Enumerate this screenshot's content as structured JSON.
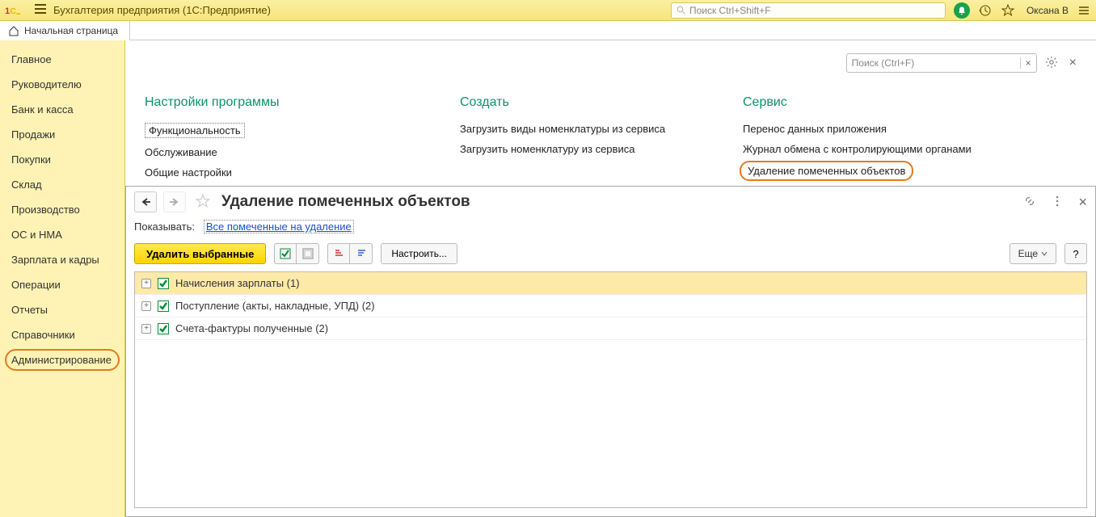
{
  "titlebar": {
    "app_title": "Бухгалтерия предприятия  (1С:Предприятие)",
    "search_placeholder": "Поиск Ctrl+Shift+F",
    "user": "Оксана В"
  },
  "tabs": {
    "home": "Начальная страница"
  },
  "sidebar": {
    "items": [
      "Главное",
      "Руководителю",
      "Банк и касса",
      "Продажи",
      "Покупки",
      "Склад",
      "Производство",
      "ОС и НМА",
      "Зарплата и кадры",
      "Операции",
      "Отчеты",
      "Справочники",
      "Администрирование"
    ]
  },
  "admin": {
    "search_placeholder": "Поиск (Ctrl+F)",
    "col1_title": "Настройки программы",
    "col1": [
      "Функциональность",
      "Обслуживание",
      "Общие настройки"
    ],
    "col2_title": "Создать",
    "col2": [
      "Загрузить виды номенклатуры из сервиса",
      "Загрузить номенклатуру из сервиса"
    ],
    "col3_title": "Сервис",
    "col3": [
      "Перенос данных приложения",
      "Журнал обмена с контролирующими органами",
      "Удаление помеченных объектов"
    ]
  },
  "overlay": {
    "title": "Удаление помеченных объектов",
    "filter_label": "Показывать:",
    "filter_link": "Все помеченные на удаление",
    "delete_btn": "Удалить выбранные",
    "configure_btn": "Настроить...",
    "more_btn": "Еще",
    "help_btn": "?",
    "rows": [
      "Начисления зарплаты (1)",
      "Поступление (акты, накладные, УПД) (2)",
      "Счета-фактуры полученные (2)"
    ]
  }
}
